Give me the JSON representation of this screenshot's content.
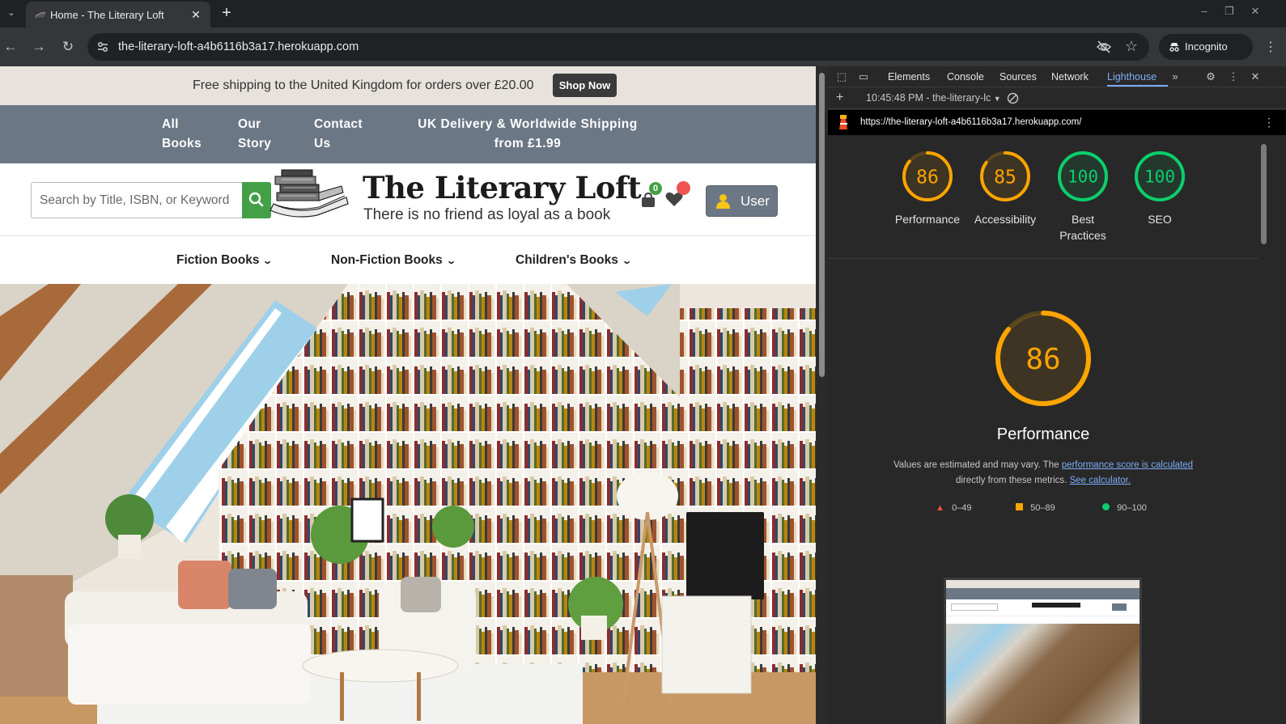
{
  "browser": {
    "tab_title": "Home - The Literary Loft",
    "url": "the-literary-loft-a4b6116b3a17.herokuapp.com",
    "incognito_label": "Incognito"
  },
  "site": {
    "announcement": "Free shipping to the United Kingdom for orders over £20.00",
    "shop_now": "Shop Now",
    "topnav": {
      "all_books_1": "All",
      "all_books_2": "Books",
      "our_story_1": "Our",
      "our_story_2": "Story",
      "contact_1": "Contact",
      "contact_2": "Us",
      "shipping_1": "UK Delivery & Worldwide Shipping",
      "shipping_2": "from £1.99"
    },
    "search_placeholder": "Search by Title, ISBN, or Keyword",
    "brand": "The Literary Loft",
    "tagline": "There is no friend as loyal as a book",
    "bag_count": "0",
    "user_label": "User",
    "categories": [
      "Fiction Books",
      "Non-Fiction Books",
      "Children's Books"
    ]
  },
  "devtools": {
    "tabs": [
      "Elements",
      "Console",
      "Sources",
      "Network",
      "Lighthouse"
    ],
    "active_tab": "Lighthouse",
    "report_select": "10:45:48 PM - the-literary-lc",
    "report_url": "https://the-literary-loft-a4b6116b3a17.herokuapp.com/",
    "scores": [
      {
        "label": "Performance",
        "value": 86,
        "color": "#ffa400"
      },
      {
        "label": "Accessibility",
        "value": 85,
        "color": "#ffa400"
      },
      {
        "label": "Best Practices",
        "value": 100,
        "color": "#0cce6b"
      },
      {
        "label": "SEO",
        "value": 100,
        "color": "#0cce6b"
      }
    ],
    "big_score": 86,
    "big_title": "Performance",
    "note_text": "Values are estimated and may vary. The ",
    "note_link1": "performance score is calculated",
    "note_text2": "directly from these metrics. ",
    "note_link2": "See calculator.",
    "legend": [
      "0–49",
      "50–89",
      "90–100"
    ],
    "colors": {
      "fail": "#ff4e42",
      "average": "#ffa400",
      "pass": "#0cce6b",
      "link": "#7cacf8"
    }
  }
}
